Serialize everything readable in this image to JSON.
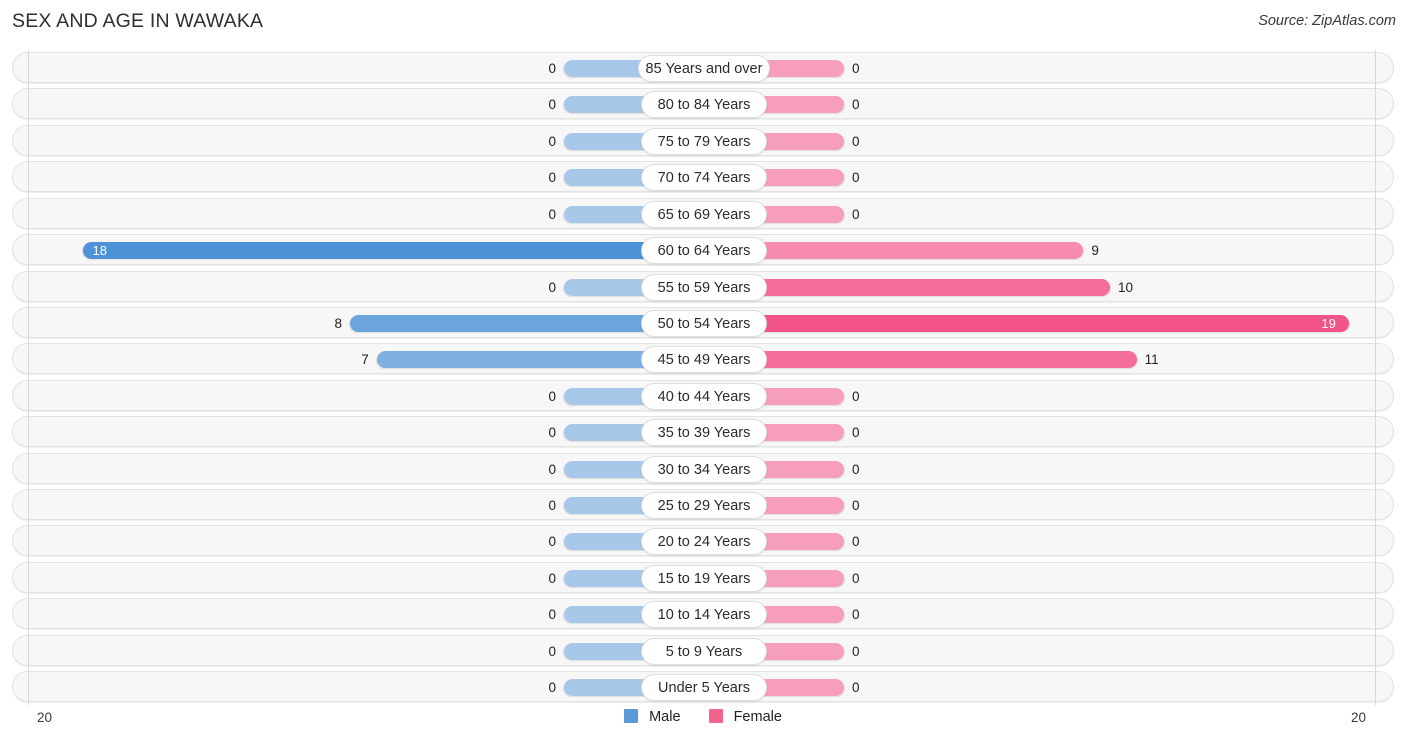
{
  "header": {
    "title": "SEX AND AGE IN WAWAKA",
    "source": "Source: ZipAtlas.com"
  },
  "legend": {
    "male": {
      "label": "Male",
      "color": "#5b9bd5"
    },
    "female": {
      "label": "Female",
      "color": "#f4638f"
    }
  },
  "axis": {
    "max_left": "20",
    "max_right": "20"
  },
  "chart_data": {
    "type": "bar",
    "subtype": "population-pyramid",
    "title": "SEX AND AGE IN WAWAKA",
    "xlabel": "",
    "ylabel": "",
    "axis_max": 20,
    "xlim": [
      20,
      20
    ],
    "grid": false,
    "legend_position": "bottom-center",
    "categories": [
      "85 Years and over",
      "80 to 84 Years",
      "75 to 79 Years",
      "70 to 74 Years",
      "65 to 69 Years",
      "60 to 64 Years",
      "55 to 59 Years",
      "50 to 54 Years",
      "45 to 49 Years",
      "40 to 44 Years",
      "35 to 39 Years",
      "30 to 34 Years",
      "25 to 29 Years",
      "20 to 24 Years",
      "15 to 19 Years",
      "10 to 14 Years",
      "5 to 9 Years",
      "Under 5 Years"
    ],
    "series": [
      {
        "name": "Male",
        "color": "#5b9bd5",
        "values": [
          0,
          0,
          0,
          0,
          0,
          18,
          0,
          8,
          7,
          0,
          0,
          0,
          0,
          0,
          0,
          0,
          0,
          0
        ]
      },
      {
        "name": "Female",
        "color": "#f4638f",
        "values": [
          0,
          0,
          0,
          0,
          0,
          9,
          10,
          19,
          11,
          0,
          0,
          0,
          0,
          0,
          0,
          0,
          0,
          0
        ]
      }
    ],
    "rows": [
      {
        "label": "85 Years and over",
        "male": 0,
        "male_text": "0",
        "female": 0,
        "female_text": "0"
      },
      {
        "label": "80 to 84 Years",
        "male": 0,
        "male_text": "0",
        "female": 0,
        "female_text": "0"
      },
      {
        "label": "75 to 79 Years",
        "male": 0,
        "male_text": "0",
        "female": 0,
        "female_text": "0"
      },
      {
        "label": "70 to 74 Years",
        "male": 0,
        "male_text": "0",
        "female": 0,
        "female_text": "0"
      },
      {
        "label": "65 to 69 Years",
        "male": 0,
        "male_text": "0",
        "female": 0,
        "female_text": "0"
      },
      {
        "label": "60 to 64 Years",
        "male": 18,
        "male_text": "18",
        "female": 9,
        "female_text": "9"
      },
      {
        "label": "55 to 59 Years",
        "male": 0,
        "male_text": "0",
        "female": 10,
        "female_text": "10"
      },
      {
        "label": "50 to 54 Years",
        "male": 8,
        "male_text": "8",
        "female": 19,
        "female_text": "19"
      },
      {
        "label": "45 to 49 Years",
        "male": 7,
        "male_text": "7",
        "female": 11,
        "female_text": "11"
      },
      {
        "label": "40 to 44 Years",
        "male": 0,
        "male_text": "0",
        "female": 0,
        "female_text": "0"
      },
      {
        "label": "35 to 39 Years",
        "male": 0,
        "male_text": "0",
        "female": 0,
        "female_text": "0"
      },
      {
        "label": "30 to 34 Years",
        "male": 0,
        "male_text": "0",
        "female": 0,
        "female_text": "0"
      },
      {
        "label": "25 to 29 Years",
        "male": 0,
        "male_text": "0",
        "female": 0,
        "female_text": "0"
      },
      {
        "label": "20 to 24 Years",
        "male": 0,
        "male_text": "0",
        "female": 0,
        "female_text": "0"
      },
      {
        "label": "15 to 19 Years",
        "male": 0,
        "male_text": "0",
        "female": 0,
        "female_text": "0"
      },
      {
        "label": "10 to 14 Years",
        "male": 0,
        "male_text": "0",
        "female": 0,
        "female_text": "0"
      },
      {
        "label": "5 to 9 Years",
        "male": 0,
        "male_text": "0",
        "female": 0,
        "female_text": "0"
      },
      {
        "label": "Under 5 Years",
        "male": 0,
        "male_text": "0",
        "female": 0,
        "female_text": "0"
      }
    ]
  }
}
